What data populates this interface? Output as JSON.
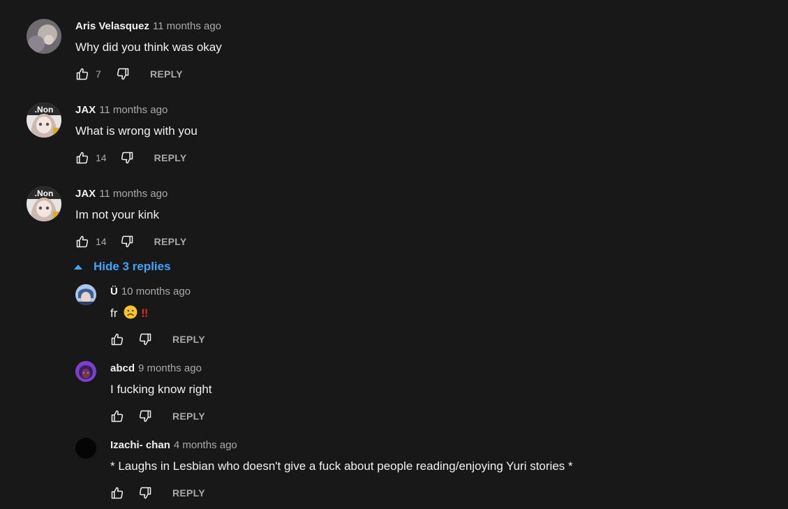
{
  "comments": [
    {
      "author": "Aris Velasquez",
      "time": "11 months ago",
      "text": "Why did you think was okay",
      "likes": "7",
      "reply_label": "REPLY"
    },
    {
      "author": "JAX",
      "time": "11 months ago",
      "text": "What is wrong with you",
      "likes": "14",
      "reply_label": "REPLY",
      "avatar_text": ".Non"
    },
    {
      "author": "JAX",
      "time": "11 months ago",
      "text": "Im not your kink",
      "likes": "14",
      "reply_label": "REPLY",
      "avatar_text": ".Non"
    }
  ],
  "replies_toggle": {
    "label": "Hide 3 replies"
  },
  "replies": [
    {
      "author": "Ü",
      "time": "10 months ago",
      "text": "fr",
      "emoji": [
        "frowning-face",
        "double-exclamation"
      ],
      "bang": "‼",
      "likes": "",
      "reply_label": "REPLY"
    },
    {
      "author": "abcd",
      "time": "9 months ago",
      "text": "I fucking know right",
      "likes": "",
      "reply_label": "REPLY"
    },
    {
      "author": "Izachi- chan",
      "time": "4 months ago",
      "text": "* Laughs in Lesbian who doesn't give a fuck about people reading/enjoying Yuri stories *",
      "likes": "",
      "reply_label": "REPLY"
    }
  ],
  "colors": {
    "background": "#181818",
    "text": "#f1f1f1",
    "secondary": "#aaaaaa",
    "link": "#3ea6ff"
  }
}
